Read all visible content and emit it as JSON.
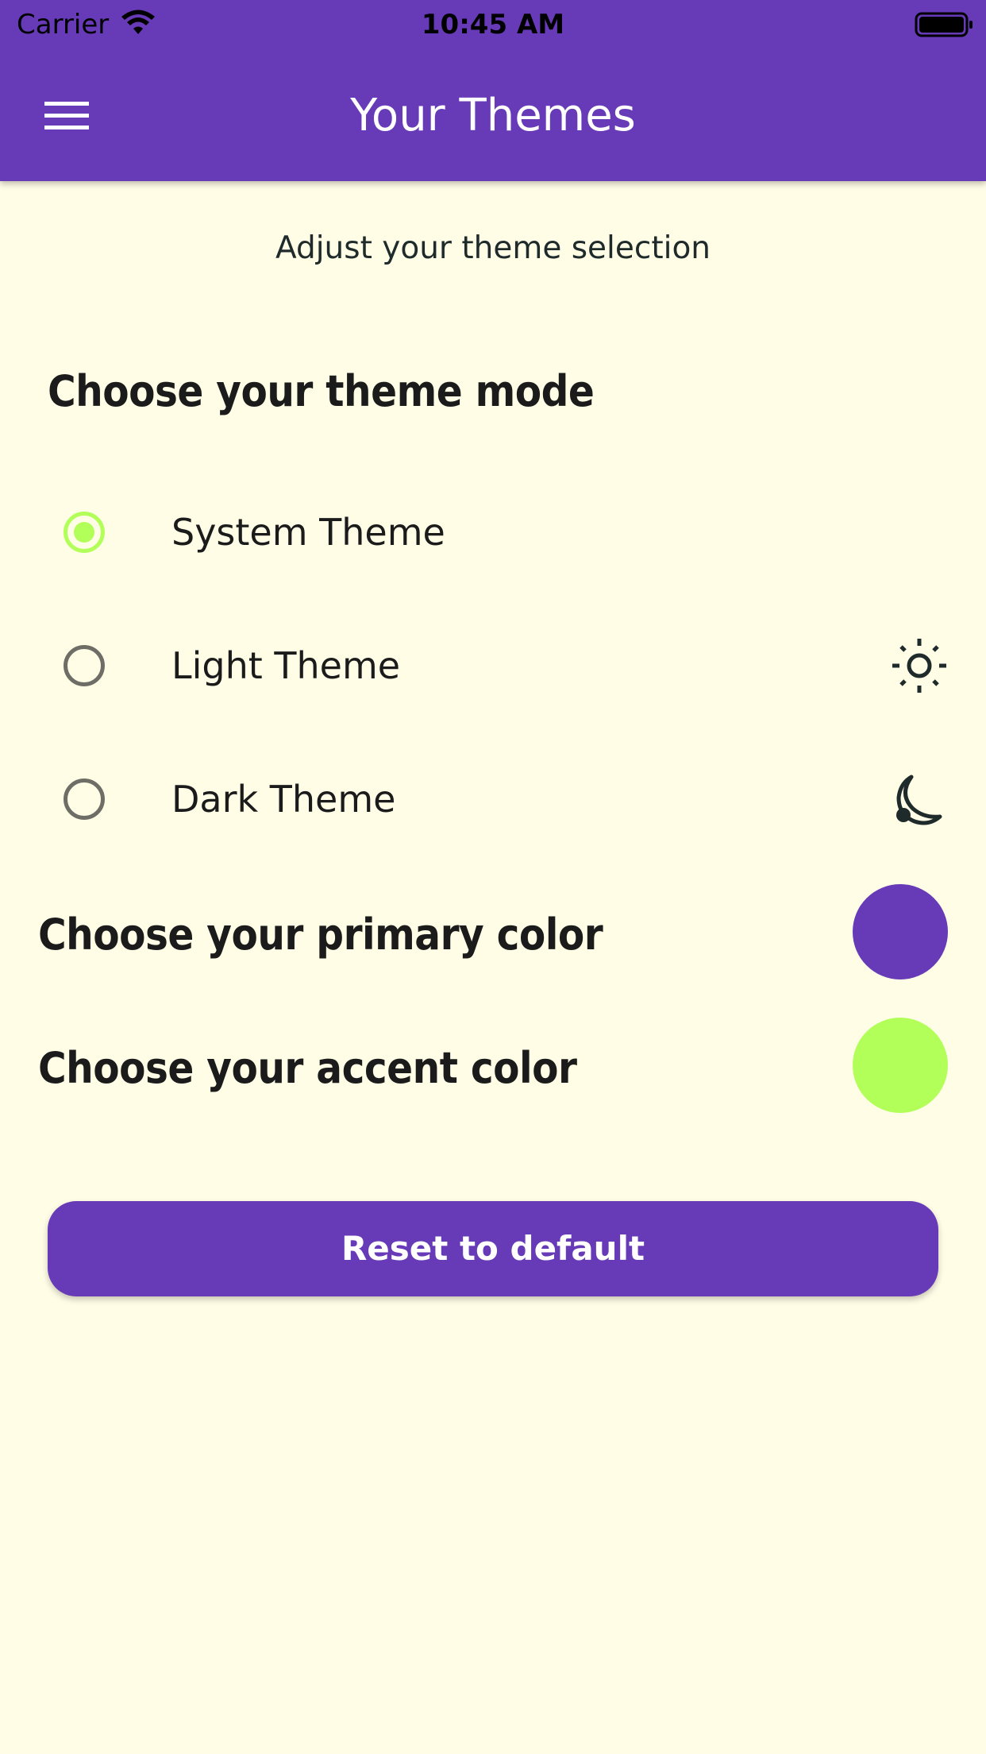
{
  "status_bar": {
    "carrier": "Carrier",
    "time": "10:45 AM"
  },
  "app_bar": {
    "title": "Your Themes",
    "menu_icon": "menu-icon",
    "background_color": "#673AB7"
  },
  "subtitle": "Adjust your theme selection",
  "theme_mode": {
    "heading": "Choose your theme mode",
    "selected": "System Theme",
    "options": [
      {
        "label": "System Theme",
        "selected": true,
        "icon": null
      },
      {
        "label": "Light Theme",
        "selected": false,
        "icon": "sun-icon"
      },
      {
        "label": "Dark Theme",
        "selected": false,
        "icon": "moon-icon"
      }
    ]
  },
  "primary_color": {
    "heading": "Choose your primary color",
    "value": "#673AB7"
  },
  "accent_color": {
    "heading": "Choose your accent color",
    "value": "#B2FF59"
  },
  "reset_button": {
    "label": "Reset to default"
  },
  "colors": {
    "background": "#FFFDE6",
    "text": "#1B1B1B",
    "radio_unselected": "#6E6E66"
  }
}
